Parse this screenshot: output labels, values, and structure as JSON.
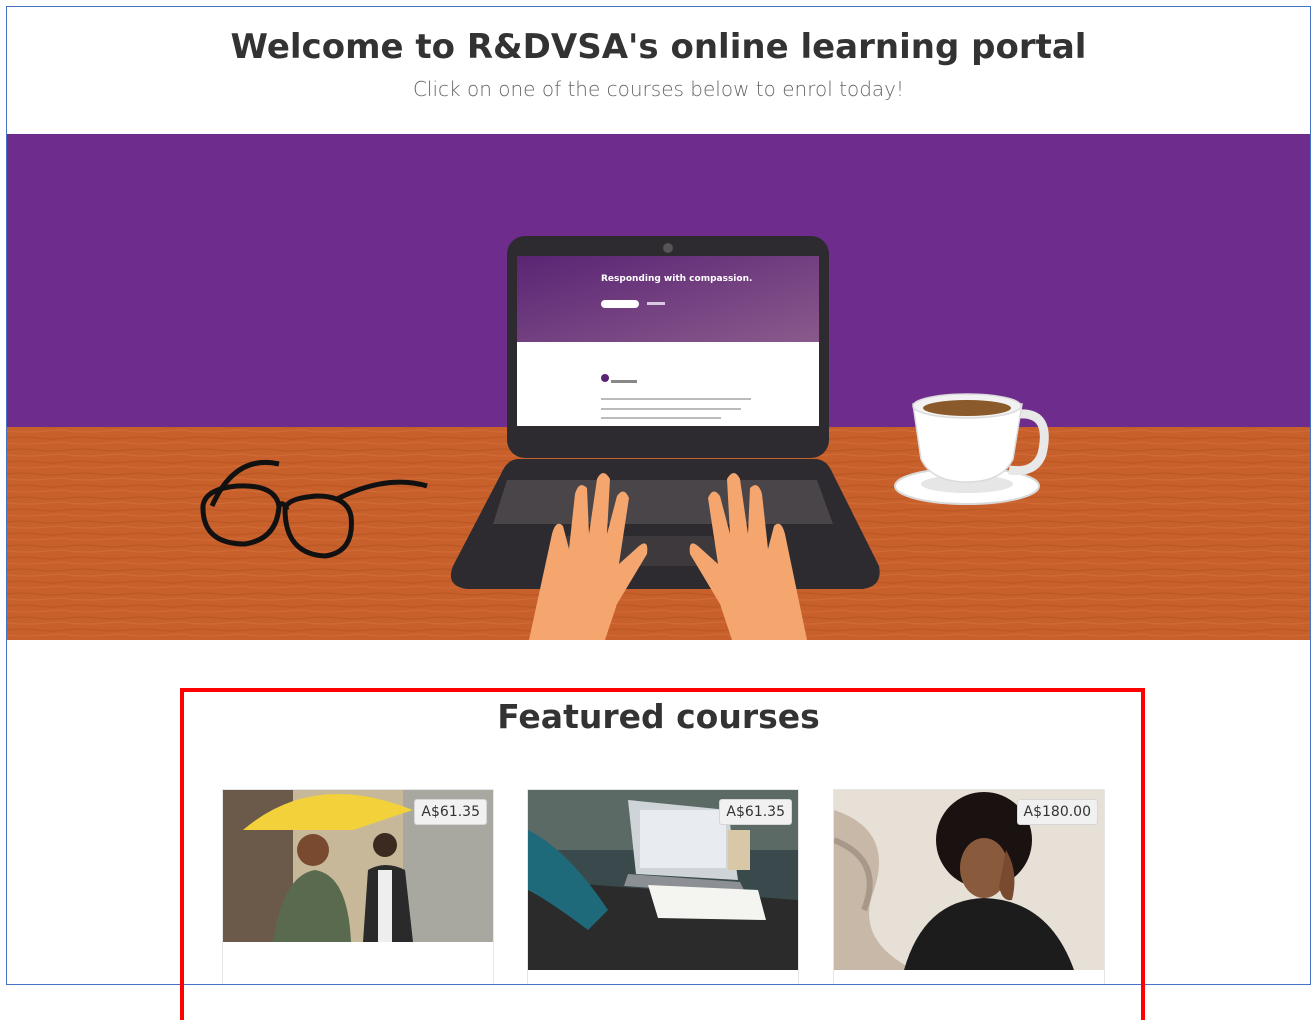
{
  "header": {
    "title": "Welcome to R&DVSA's online learning portal",
    "subtitle": "Click on one of the courses below to enrol today!"
  },
  "hero": {
    "screen_heading": "Responding with compassion.",
    "colors": {
      "wall": "#6e2d8c",
      "desk": "#c8602c",
      "laptop": "#2d2a30",
      "skin": "#f4a66e"
    }
  },
  "featured": {
    "title": "Featured courses",
    "courses": [
      {
        "price": "A$61.35",
        "image": "people-with-umbrella-photo"
      },
      {
        "price": "A$61.35",
        "image": "laptop-desk-photo"
      },
      {
        "price": "A$180.00",
        "image": "woman-on-phone-photo"
      }
    ]
  },
  "annotation": {
    "color": "#ff0000"
  }
}
